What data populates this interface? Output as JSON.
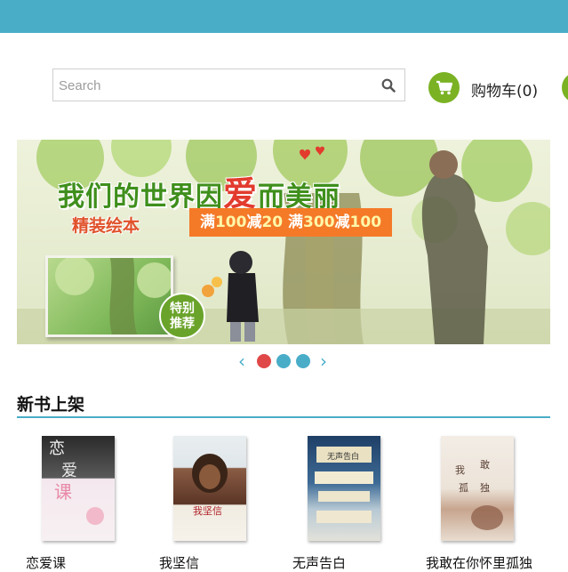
{
  "header": {
    "bar_color": "#49adc8"
  },
  "search": {
    "placeholder": "Search",
    "value": ""
  },
  "cart": {
    "label": "购物车(0)",
    "icon": "shopping-cart-icon",
    "accent": "#7ab224"
  },
  "banner": {
    "headline_part1": "我们的世界因",
    "headline_highlight": "爱",
    "headline_part2": "而美丽",
    "subtitle": "精装绘本",
    "promo": {
      "part1": "满",
      "num1": "100",
      "part2": "减",
      "num2": "20",
      "part3": " 满",
      "num3": "300",
      "part4": "减",
      "num4": "100"
    },
    "badge_line1": "特别",
    "badge_line2": "推荐"
  },
  "carousel": {
    "prev_icon": "chevron-left-icon",
    "next_icon": "chevron-right-icon",
    "active_index": 0,
    "slide_count": 3
  },
  "new_books": {
    "title": "新书上架",
    "items": [
      {
        "title": "恋爱课"
      },
      {
        "title": "我坚信"
      },
      {
        "title": "无声告白"
      },
      {
        "title": "我敢在你怀里孤独"
      }
    ]
  }
}
